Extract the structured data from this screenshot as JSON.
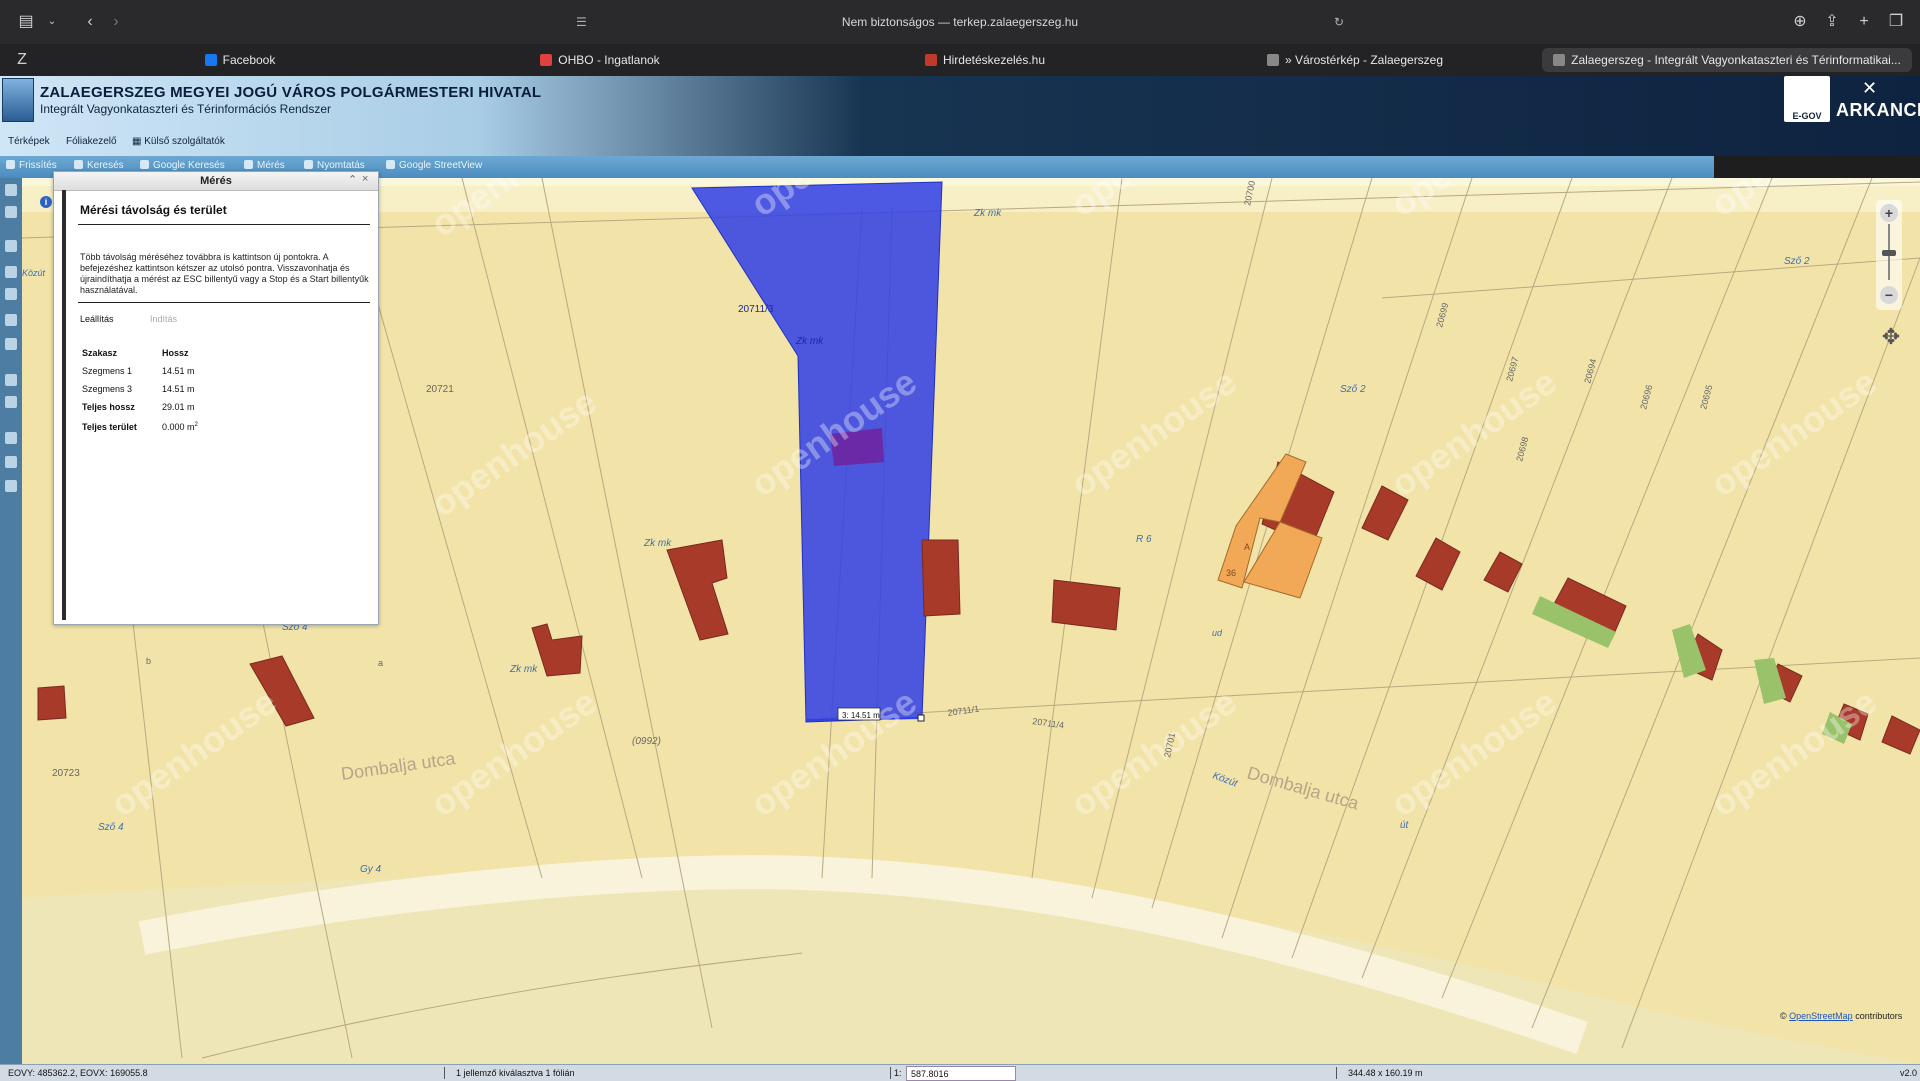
{
  "browser": {
    "address": "Nem biztonságos — terkep.zalaegerszeg.hu",
    "tabs": [
      {
        "label": "Facebook",
        "color": "#1877f2"
      },
      {
        "label": "OHBO - Ingatlanok",
        "color": "#e04040"
      },
      {
        "label": "Hirdetéskezelés.hu",
        "color": "#c0392b"
      },
      {
        "label": "» Várostérkép - Zalaegerszeg",
        "color": "#888888"
      },
      {
        "label": "Zalaegerszeg - Integrált Vagyonkataszteri és Térinformatikai...",
        "color": "#888888"
      }
    ]
  },
  "header": {
    "title": "ZALAEGERSZEG MEGYEI JOGÚ VÁROS POLGÁRMESTERI HIVATAL",
    "subtitle": "Integrált Vagyonkataszteri és Térinformációs Rendszer",
    "logo_egov": "E-GOV",
    "logo_arkance": "ARKANCE",
    "menu": [
      "Térképek",
      "Fóliakezelő",
      "Külső szolgáltatók"
    ]
  },
  "toolbar": [
    "Frissítés",
    "Keresés",
    "Google Keresés",
    "Mérés",
    "Nyomtatás",
    "Google StreetView"
  ],
  "panel": {
    "title": "Mérés",
    "heading": "Mérési távolság és terület",
    "instructions": "Több távolság méréséhez továbbra is kattintson új pontokra. A befejezéshez kattintson kétszer az utolsó pontra. Visszavonhatja és újraindíthatja a mérést az ESC billentyű vagy a Stop és a Start billentyűk használatával.",
    "stop_label": "Leállítás",
    "start_label": "Indítás",
    "col_section": "Szakasz",
    "col_length": "Hossz",
    "rows": [
      {
        "k": "Szegmens 1",
        "v": "14.51 m"
      },
      {
        "k": "Szegmens 3",
        "v": "14.51 m"
      },
      {
        "k": "Teljes hossz",
        "v": "29.01 m"
      }
    ],
    "area_label": "Teljes terület",
    "area_value": "0.000 m",
    "area_unit_sup": "2"
  },
  "map": {
    "measure_tooltip": "3: 14.51 m",
    "labels": {
      "street": "Dombalja utca",
      "road_code": "(0992)",
      "parcels": [
        "20721",
        "20723",
        "20711/3",
        "20711/1",
        "20711/4",
        "20700",
        "20699",
        "20697",
        "20696",
        "20695",
        "20694",
        "20698",
        "20701"
      ],
      "zones": [
        "Zk mk",
        "Zk mk",
        "Zk mk",
        "Zk mk",
        "Sző 2",
        "Sző 2",
        "Sző 4",
        "Sző 4",
        "Gy 4",
        "R 6",
        "út",
        "Közút"
      ],
      "small": [
        "a",
        "b",
        "ud",
        "A",
        "36",
        "Közút"
      ]
    },
    "watermark": "openhouse",
    "attribution_link": "OpenStreetMap",
    "attribution_suffix": " contributors",
    "copyright": "©",
    "version": "v2.0"
  },
  "status": {
    "coords": "EOVY: 485362.2, EOVX: 169055.8",
    "selection": "1 jellemző kiválasztva 1 fólián",
    "scale_prefix": "1:",
    "scale_value": "587.8016",
    "extent": "344.48 x 160.19 m"
  }
}
